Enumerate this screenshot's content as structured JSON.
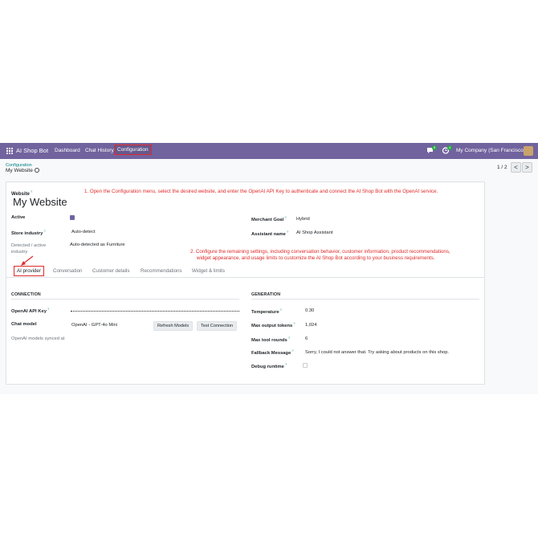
{
  "nav": {
    "brand": "AI Shop Bot",
    "menus": [
      "Dashboard",
      "Chat History",
      "Configuration"
    ],
    "active_menu": "Configuration",
    "chat_badge": "8",
    "activity_badge": "4",
    "company": "My Company (San Francisco)",
    "icons": [
      "apps-grid-icon",
      "chat-icon",
      "clock-icon",
      "avatar"
    ]
  },
  "breadcrumb": {
    "parent": "Configuration",
    "current": "My Website"
  },
  "pager": {
    "text": "1 / 2",
    "prev": "<",
    "next": ">"
  },
  "form": {
    "website_label": "Website",
    "website_value": "My Website",
    "active_label": "Active",
    "active_checked": true,
    "store_industry_label": "Store industry",
    "store_industry_value": "Auto-detect",
    "detected_label": "Detected / active industry",
    "detected_value": "Auto-detected as Furniture",
    "merchant_goal_label": "Merchant Goal",
    "merchant_goal_value": "Hybrid",
    "assistant_name_label": "Assistant name",
    "assistant_name_value": "AI Shop Assistant"
  },
  "annotations": {
    "step1": "1. Open the Configuration menu, select the desired website, and enter the OpenAI API Key to authenticate and connect the AI Shop Bot with the OpenAI service.",
    "step2_line1": "2. Configure the remaining settings, including conversation behavior, customer information, product recommendations,",
    "step2_line2": "widget appearance, and usage limits to customize the AI Shop Bot according to your business requirements."
  },
  "tabs": [
    "AI provider",
    "Conversation",
    "Customer details",
    "Recommendations",
    "Widget & limits"
  ],
  "active_tab": "AI provider",
  "connection": {
    "heading": "CONNECTION",
    "api_key_label": "OpenAI API Key",
    "chat_model_label": "Chat model",
    "chat_model_value": "OpenAI - GPT-4o Mini",
    "refresh_button": "Refresh Models",
    "test_button": "Test Connection",
    "synced_label": "OpenAI models synced at"
  },
  "generation": {
    "heading": "GENERATION",
    "temperature_label": "Temperature",
    "temperature_value": "0.30",
    "max_tokens_label": "Max output tokens",
    "max_tokens_value": "1,024",
    "max_tool_label": "Max tool rounds",
    "max_tool_value": "6",
    "fallback_label": "Fallback Message",
    "fallback_value": "Sorry, I could not answer that. Try asking about products on this shop.",
    "debug_label": "Debug runtime",
    "debug_checked": false
  },
  "colors": {
    "brand": "#71639e",
    "annotation": "#e02b2b",
    "link": "#017e84"
  }
}
